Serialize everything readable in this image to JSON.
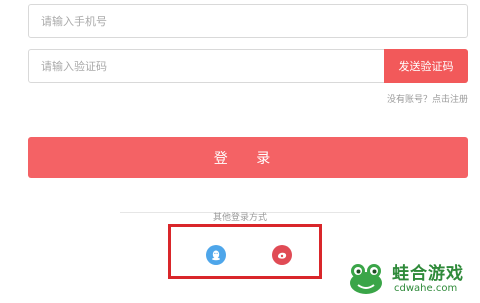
{
  "phone_field": {
    "placeholder": "请输入手机号"
  },
  "code_field": {
    "placeholder": "请输入验证码",
    "send_button": "发送验证码"
  },
  "register_link": "没有账号？点击注册",
  "login_button": "登 录",
  "other_login": {
    "label": "其他登录方式",
    "options": [
      {
        "name": "qq",
        "icon": "qq-penguin-icon",
        "color": "#4ea6ea"
      },
      {
        "name": "weibo",
        "icon": "weibo-icon",
        "color": "#e04b55"
      }
    ]
  },
  "watermark": {
    "name": "蛙合游戏",
    "url": "cdwahe.com",
    "color": "#2f8a3a"
  },
  "colors": {
    "accent": "#f46265",
    "highlight": "#d9262a"
  }
}
